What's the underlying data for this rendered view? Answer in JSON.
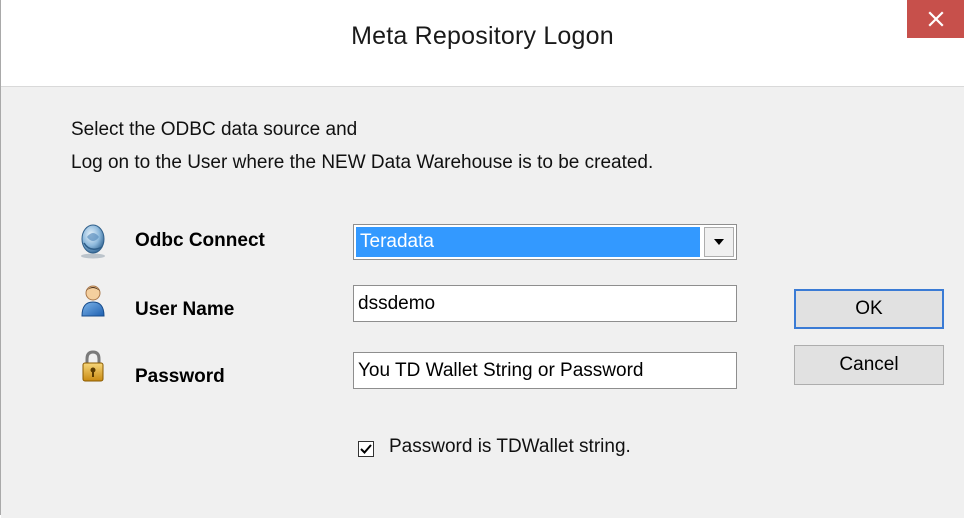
{
  "window": {
    "title": "Meta Repository Logon",
    "close_glyph": "✕"
  },
  "instructions": {
    "line1": "Select the ODBC data source and",
    "line2": "Log on to the User where the NEW Data Warehouse is to be created."
  },
  "fields": {
    "odbc": {
      "label": "Odbc Connect",
      "value": "Teradata",
      "icon": "odbc-connect-icon"
    },
    "username": {
      "label": "User Name",
      "value": "dssdemo",
      "icon": "user-icon"
    },
    "password": {
      "label": "Password",
      "value": "You TD Wallet String or Password",
      "icon": "padlock-icon"
    }
  },
  "checkbox": {
    "label": "Password is TDWallet string.",
    "checked": true
  },
  "buttons": {
    "ok": "OK",
    "cancel": "Cancel"
  },
  "colors": {
    "close_button": "#c7504b",
    "selection": "#3399ff",
    "dialog_background": "#f0f0f0"
  }
}
